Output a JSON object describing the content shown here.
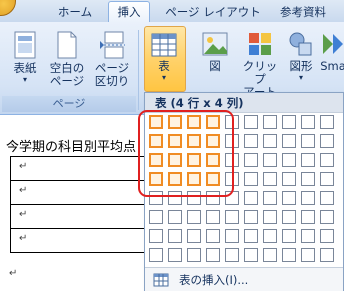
{
  "tabs": [
    {
      "label": "ホーム",
      "active": false
    },
    {
      "label": "挿入",
      "active": true
    },
    {
      "label": "ページ レイアウト",
      "active": false
    },
    {
      "label": "参考資料",
      "active": false
    }
  ],
  "ribbon": {
    "pages_group": {
      "label": "ページ",
      "cover": {
        "line1": "表紙",
        "line2": ""
      },
      "blank": {
        "line1": "空白の",
        "line2": "ページ"
      },
      "break": {
        "line1": "ページ",
        "line2": "区切り"
      }
    },
    "table_button": {
      "label": "表"
    },
    "figure_button": {
      "label": "図"
    },
    "clipart_button": {
      "line1": "クリップ",
      "line2": "アート"
    },
    "shapes_button": {
      "label": "図形"
    },
    "smartart_button": {
      "label": "Sma"
    }
  },
  "document": {
    "heading_text": "今学期の科目別平均点"
  },
  "table_dropdown": {
    "header": "表 (4 行 x 4 列)",
    "grid": {
      "columns": 10,
      "rows": 8,
      "selected_rows": 4,
      "selected_cols": 4
    },
    "insert_label": "表の挿入(I)..."
  },
  "colors": {
    "accent_orange": "#f08c24",
    "highlight_red": "#e02020",
    "ribbon_blue": "#d5e3f5"
  }
}
